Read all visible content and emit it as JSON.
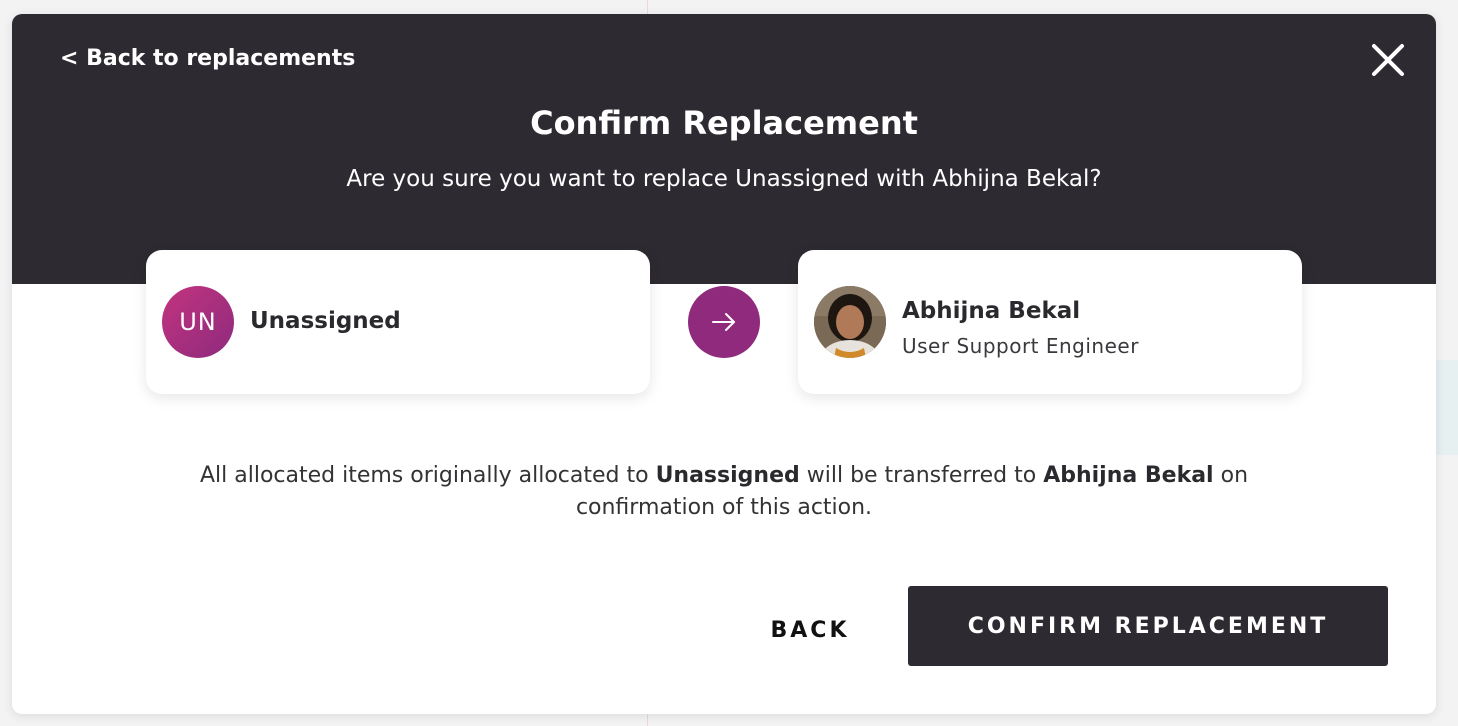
{
  "modal": {
    "back_link": "< Back to replacements",
    "title": "Confirm Replacement",
    "subtitle": "Are you sure you want to replace Unassigned with Abhijna Bekal?"
  },
  "from_person": {
    "initials": "UN",
    "name": "Unassigned"
  },
  "to_person": {
    "name": "Abhijna Bekal",
    "role": "User Support Engineer"
  },
  "info": {
    "prefix": "All allocated items originally allocated to ",
    "from_name": "Unassigned",
    "middle": " will be transferred to ",
    "to_name": "Abhijna Bekal",
    "suffix": " on confirmation of this action."
  },
  "actions": {
    "back_label": "BACK",
    "confirm_label": "CONFIRM REPLACEMENT"
  },
  "colors": {
    "header_bg": "#2e2a31",
    "accent": "#8f2a7d",
    "initials_gradient_start": "#c2347e"
  },
  "icons": {
    "close": "close-icon",
    "arrow": "arrow-right-icon"
  }
}
